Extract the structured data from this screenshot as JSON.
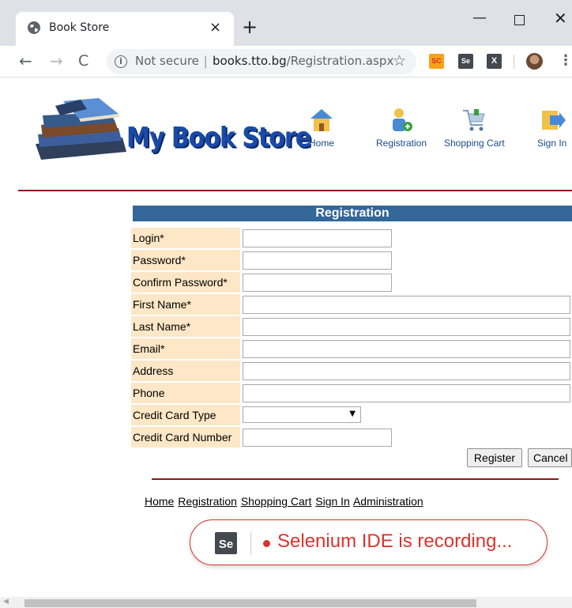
{
  "browser": {
    "tab_title": "Book Store",
    "tab_close": "×",
    "new_tab": "+",
    "window": {
      "minimize": "—",
      "close": "✕"
    },
    "nav": {
      "back": "←",
      "forward": "→",
      "reload": "C"
    },
    "security": "Not secure",
    "url_separator": "|",
    "url_host": "books.tto.bg",
    "url_path": "/Registration.aspx",
    "star": "☆",
    "extensions": {
      "sc": "SC",
      "se": "Se",
      "x": "X"
    },
    "menu": "⋮",
    "info": "i"
  },
  "site": {
    "logo_text": "My Book Store",
    "nav": [
      {
        "label": "Home",
        "icon": "home-icon"
      },
      {
        "label": "Registration",
        "icon": "registration-icon"
      },
      {
        "label": "Shopping Cart",
        "icon": "shopping-cart-icon"
      },
      {
        "label": "Sign In",
        "icon": "sign-in-icon"
      }
    ]
  },
  "form": {
    "title": "Registration",
    "fields": [
      {
        "label": "Login*",
        "value": ""
      },
      {
        "label": "Password*",
        "value": ""
      },
      {
        "label": "Confirm Password*",
        "value": ""
      },
      {
        "label": "First Name*",
        "value": ""
      },
      {
        "label": "Last Name*",
        "value": ""
      },
      {
        "label": "Email*",
        "value": ""
      },
      {
        "label": "Address",
        "value": ""
      },
      {
        "label": "Phone",
        "value": ""
      },
      {
        "label": "Credit Card Type",
        "value": ""
      },
      {
        "label": "Credit Card Number",
        "value": ""
      }
    ],
    "register_label": "Register",
    "cancel_label": "Cancel",
    "select_arrow": "▼"
  },
  "footer": {
    "links": [
      "Home",
      "Registration",
      "Shopping Cart",
      "Sign In",
      "Administration"
    ]
  },
  "selenium": {
    "logo": "Se",
    "message": "Selenium IDE is recording..."
  },
  "colors": {
    "header_blue": "#336699",
    "label_bg": "#fde7c6",
    "rule_red": "#8b1a1a",
    "recording_red": "#d8342f"
  }
}
